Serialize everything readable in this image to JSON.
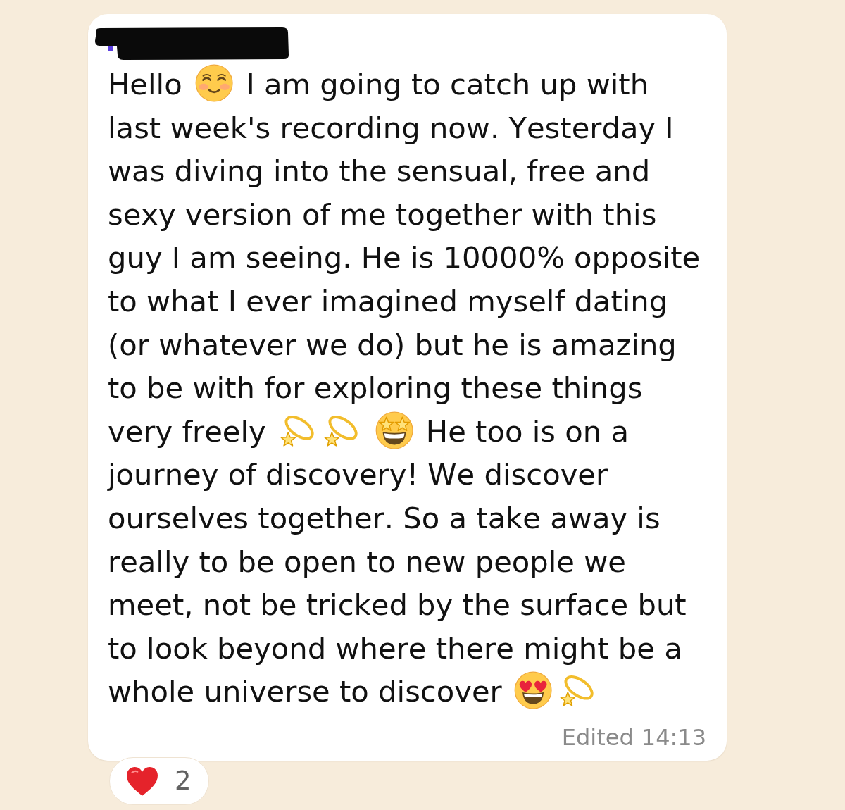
{
  "message": {
    "sender": {
      "redacted": true
    },
    "parts": [
      {
        "kind": "text",
        "text": "Hello "
      },
      {
        "kind": "smiling"
      },
      {
        "kind": "text",
        "text": " I am going to catch up with last week's recording now. Yesterday I was diving into the sensual, free and sexy version of me together with this guy I am seeing. He is 10000% opposite to what I ever imagined myself dating (or whatever we do) but he is amazing to be with for exploring these things very freely "
      },
      {
        "kind": "dizzy"
      },
      {
        "kind": "dizzy"
      },
      {
        "kind": "starstruck"
      },
      {
        "kind": "text",
        "text": " He too is on a journey of discovery! We discover ourselves together. So a take away is really to be open to new people we meet, not be tricked by the surface but to look beyond where there might be a whole universe to discover "
      },
      {
        "kind": "hearteyes"
      },
      {
        "kind": "dizzy"
      }
    ],
    "edited_label": "Edited",
    "time": "14:13"
  },
  "reactions": [
    {
      "kind": "heart",
      "count": "2"
    }
  ]
}
